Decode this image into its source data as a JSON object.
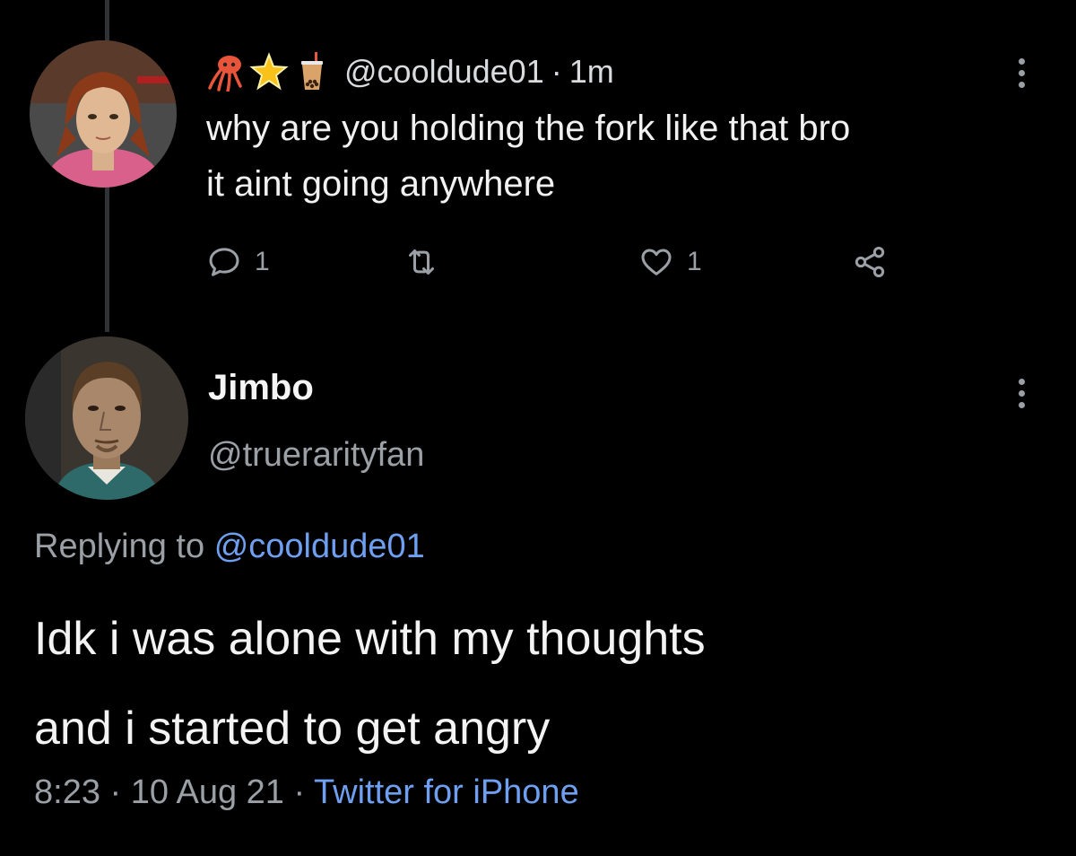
{
  "reply_tweet": {
    "emojis": [
      "squid-emoji",
      "star-emoji",
      "bubble-tea-emoji"
    ],
    "handle": "@cooldude01",
    "separator": "·",
    "time": "1m",
    "text_lines": [
      "why are you holding the fork like that bro",
      "it aint going anywhere"
    ],
    "reply_count": "1",
    "like_count": "1"
  },
  "main_tweet": {
    "display_name": "Jimbo",
    "handle": "@truerarityfan",
    "replying_prefix": "Replying to",
    "replying_to": "@cooldude01",
    "text_lines": [
      "Idk i was alone with my thoughts",
      "and i started to get angry"
    ],
    "time": "8:23",
    "separator": "·",
    "date": "10 Aug 21",
    "source": "Twitter for iPhone"
  },
  "colors": {
    "background": "#000000",
    "link": "#6f9ff0",
    "secondary_text": "#9aa0a6",
    "thread_line": "#2f3336"
  },
  "icons": [
    "reply-icon",
    "retweet-icon",
    "like-icon",
    "share-icon",
    "more-icon"
  ]
}
